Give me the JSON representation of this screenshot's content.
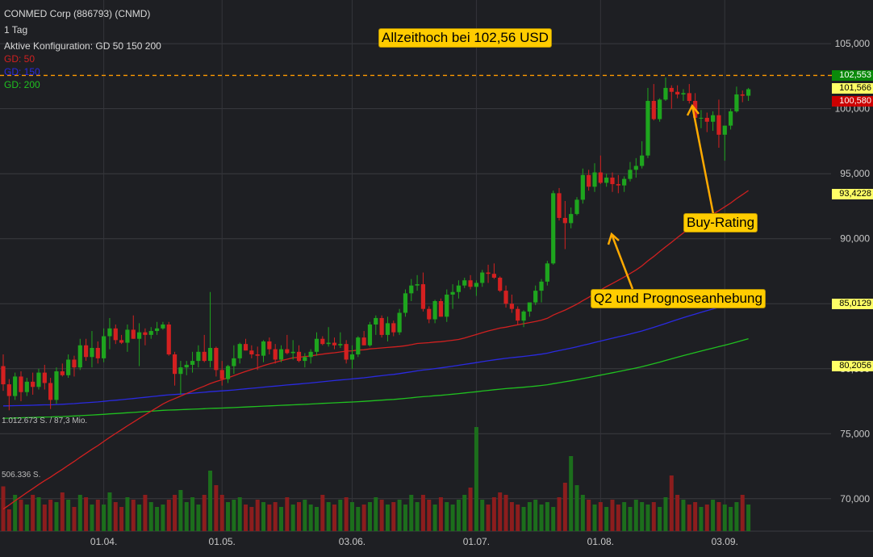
{
  "header": {
    "title": "CONMED Corp (886793) (CNMD)",
    "period": "1 Tag",
    "config": "Aktive Konfiguration: GD 50 150 200",
    "legend": [
      {
        "label": "GD: 50",
        "color": "#d02020"
      },
      {
        "label": "GD: 150",
        "color": "#2a2ae0"
      },
      {
        "label": "GD: 200",
        "color": "#20c020"
      }
    ]
  },
  "annotations": {
    "ath": "Allzeithoch bei 102,56 USD",
    "buy": "Buy-Rating",
    "q2": "Q2 und Prognoseanhebung"
  },
  "price_tags": [
    {
      "label": "102,553",
      "value": 102.553,
      "bg": "#0a8a0a",
      "fg": "#ffffff"
    },
    {
      "label": "101,566",
      "value": 101.566,
      "bg": "#ffff66",
      "fg": "#000000"
    },
    {
      "label": "100,580",
      "value": 100.58,
      "bg": "#cc0000",
      "fg": "#ffffff"
    },
    {
      "label": "93,4228",
      "value": 93.4228,
      "bg": "#ffff66",
      "fg": "#000000"
    },
    {
      "label": "85,0129",
      "value": 85.0129,
      "bg": "#ffff66",
      "fg": "#000000"
    },
    {
      "label": "80,2056",
      "value": 80.2056,
      "bg": "#ffff66",
      "fg": "#000000"
    }
  ],
  "volume_labels": {
    "max": "1.012.673 S. / 87,3 Mio.",
    "mid": "506.336 S."
  },
  "colors": {
    "up": "#1ea51e",
    "down": "#d42020",
    "gd50": "#d02020",
    "gd150": "#2a2ae0",
    "gd200": "#20c020",
    "ath_line": "#ff9900"
  },
  "chart_data": {
    "type": "candlestick",
    "x_ticks": [
      "01.04.",
      "01.05.",
      "03.06.",
      "01.07.",
      "01.08.",
      "03.09."
    ],
    "x_tick_index": [
      17,
      37,
      59,
      80,
      101,
      122
    ],
    "y_ticks": [
      70,
      75,
      80,
      85,
      90,
      95,
      100,
      105
    ],
    "y_tick_labels": [
      "70,000",
      "75,000",
      "80,000",
      "85,000",
      "90,000",
      "95,000",
      "100,000",
      "105,000"
    ],
    "ylim": [
      68,
      106.5
    ],
    "ath": 102.56,
    "candles": [
      [
        80.2,
        81.1,
        78.3,
        78.8
      ],
      [
        78.8,
        79.2,
        76.8,
        77.9
      ],
      [
        77.9,
        79.7,
        77.6,
        79.4
      ],
      [
        79.4,
        79.8,
        77.5,
        78.2
      ],
      [
        78.2,
        79.3,
        77.9,
        79.0
      ],
      [
        79.0,
        79.7,
        78.0,
        78.6
      ],
      [
        78.6,
        80.0,
        78.4,
        79.7
      ],
      [
        79.7,
        80.3,
        78.4,
        78.9
      ],
      [
        78.9,
        79.3,
        76.9,
        77.6
      ],
      [
        77.6,
        80.1,
        77.3,
        79.8
      ],
      [
        79.8,
        80.4,
        79.4,
        79.5
      ],
      [
        79.5,
        81.1,
        79.3,
        80.7
      ],
      [
        80.7,
        81.0,
        79.4,
        80.1
      ],
      [
        80.1,
        82.3,
        79.9,
        81.8
      ],
      [
        81.8,
        82.3,
        80.6,
        80.9
      ],
      [
        80.9,
        82.9,
        80.1,
        81.6
      ],
      [
        81.6,
        82.1,
        80.4,
        80.8
      ],
      [
        80.8,
        83.1,
        80.5,
        82.5
      ],
      [
        82.5,
        83.9,
        81.5,
        83.1
      ],
      [
        83.1,
        83.4,
        81.9,
        82.2
      ],
      [
        82.2,
        82.6,
        81.9,
        82.0
      ],
      [
        82.0,
        83.4,
        81.3,
        83.0
      ],
      [
        83.0,
        84.1,
        82.3,
        82.3
      ],
      [
        82.3,
        83.5,
        80.2,
        82.8
      ],
      [
        82.8,
        83.1,
        81.8,
        82.6
      ],
      [
        82.6,
        83.2,
        82.3,
        82.9
      ],
      [
        82.9,
        83.6,
        82.6,
        83.1
      ],
      [
        83.1,
        83.6,
        83.0,
        83.4
      ],
      [
        83.4,
        83.6,
        81.0,
        81.1
      ],
      [
        81.1,
        81.3,
        78.7,
        79.6
      ],
      [
        79.6,
        80.6,
        78.0,
        80.1
      ],
      [
        80.1,
        80.6,
        79.5,
        80.3
      ],
      [
        80.3,
        81.3,
        79.7,
        80.6
      ],
      [
        80.6,
        81.8,
        80.1,
        81.3
      ],
      [
        81.3,
        82.6,
        80.5,
        80.6
      ],
      [
        80.6,
        85.9,
        80.1,
        81.6
      ],
      [
        81.6,
        81.7,
        79.4,
        79.9
      ],
      [
        79.9,
        80.6,
        78.7,
        79.2
      ],
      [
        79.2,
        80.3,
        78.9,
        80.2
      ],
      [
        80.2,
        81.8,
        79.6,
        80.8
      ],
      [
        80.8,
        82.0,
        80.4,
        81.9
      ],
      [
        81.9,
        82.3,
        81.4,
        81.4
      ],
      [
        81.4,
        81.8,
        80.8,
        81.1
      ],
      [
        81.1,
        81.7,
        79.9,
        81.0
      ],
      [
        81.0,
        82.2,
        80.5,
        82.1
      ],
      [
        82.1,
        82.4,
        81.1,
        81.5
      ],
      [
        81.5,
        81.9,
        80.4,
        80.7
      ],
      [
        80.7,
        81.8,
        80.5,
        81.5
      ],
      [
        81.5,
        82.6,
        81.1,
        81.2
      ],
      [
        81.2,
        82.2,
        80.7,
        81.3
      ],
      [
        81.3,
        81.8,
        80.5,
        80.6
      ],
      [
        80.6,
        81.2,
        80.1,
        80.9
      ],
      [
        80.9,
        81.5,
        80.4,
        81.3
      ],
      [
        81.3,
        82.8,
        81.0,
        82.3
      ],
      [
        82.3,
        82.5,
        81.8,
        81.9
      ],
      [
        81.9,
        83.2,
        81.7,
        82.0
      ],
      [
        82.0,
        82.4,
        81.5,
        81.8
      ],
      [
        81.8,
        82.8,
        81.6,
        81.9
      ],
      [
        81.9,
        82.2,
        80.4,
        80.7
      ],
      [
        80.7,
        81.8,
        80.0,
        81.1
      ],
      [
        81.1,
        82.5,
        80.9,
        82.4
      ],
      [
        82.4,
        82.9,
        81.8,
        81.8
      ],
      [
        81.8,
        83.6,
        81.7,
        83.4
      ],
      [
        83.4,
        84.1,
        82.6,
        83.9
      ],
      [
        83.9,
        84.1,
        82.4,
        82.6
      ],
      [
        82.6,
        84.0,
        82.1,
        83.5
      ],
      [
        83.5,
        83.7,
        82.5,
        82.8
      ],
      [
        82.8,
        84.6,
        82.6,
        84.3
      ],
      [
        84.3,
        86.1,
        84.0,
        85.8
      ],
      [
        85.8,
        86.9,
        85.2,
        86.4
      ],
      [
        86.4,
        87.2,
        86.0,
        86.5
      ],
      [
        86.5,
        87.4,
        84.4,
        84.6
      ],
      [
        84.6,
        84.8,
        83.5,
        83.8
      ],
      [
        83.8,
        85.3,
        83.5,
        85.2
      ],
      [
        85.2,
        85.4,
        84.0,
        84.0
      ],
      [
        84.0,
        86.1,
        83.6,
        85.7
      ],
      [
        85.7,
        86.5,
        84.6,
        85.9
      ],
      [
        85.9,
        86.8,
        85.4,
        86.4
      ],
      [
        86.4,
        87.0,
        86.2,
        86.8
      ],
      [
        86.8,
        87.2,
        86.1,
        86.3
      ],
      [
        86.3,
        86.8,
        85.6,
        86.6
      ],
      [
        86.6,
        87.6,
        86.3,
        87.4
      ],
      [
        87.4,
        88.0,
        86.6,
        87.3
      ],
      [
        87.3,
        88.1,
        86.9,
        87.0
      ],
      [
        87.0,
        87.1,
        85.9,
        86.0
      ],
      [
        86.0,
        86.4,
        84.7,
        85.0
      ],
      [
        85.0,
        85.7,
        84.3,
        84.6
      ],
      [
        84.6,
        84.8,
        83.4,
        83.7
      ],
      [
        83.7,
        84.5,
        83.2,
        84.4
      ],
      [
        84.4,
        85.0,
        84.0,
        85.1
      ],
      [
        85.1,
        86.4,
        84.9,
        86.0
      ],
      [
        86.0,
        86.9,
        85.1,
        86.7
      ],
      [
        86.7,
        88.3,
        86.4,
        88.1
      ],
      [
        88.1,
        93.7,
        88.0,
        93.5
      ],
      [
        93.5,
        93.9,
        91.4,
        91.6
      ],
      [
        91.6,
        92.9,
        89.2,
        91.2
      ],
      [
        91.2,
        92.4,
        90.8,
        91.9
      ],
      [
        91.9,
        93.2,
        91.8,
        93.0
      ],
      [
        93.0,
        95.4,
        92.7,
        94.9
      ],
      [
        94.9,
        95.3,
        93.7,
        94.0
      ],
      [
        94.0,
        95.8,
        93.6,
        95.1
      ],
      [
        95.1,
        96.4,
        94.2,
        94.3
      ],
      [
        94.3,
        95.0,
        94.0,
        94.7
      ],
      [
        94.7,
        95.1,
        93.6,
        94.2
      ],
      [
        94.2,
        94.9,
        93.5,
        94.1
      ],
      [
        94.1,
        94.8,
        93.6,
        94.6
      ],
      [
        94.6,
        95.9,
        94.4,
        95.3
      ],
      [
        95.3,
        96.2,
        94.7,
        95.6
      ],
      [
        95.6,
        97.5,
        95.4,
        96.4
      ],
      [
        96.4,
        101.6,
        96.2,
        100.6
      ],
      [
        100.6,
        101.9,
        99.1,
        99.2
      ],
      [
        99.2,
        100.8,
        99.0,
        100.7
      ],
      [
        100.7,
        102.4,
        100.6,
        101.6
      ],
      [
        101.6,
        101.8,
        100.0,
        101.3
      ],
      [
        101.3,
        101.8,
        100.8,
        101.1
      ],
      [
        101.1,
        101.5,
        100.6,
        101.2
      ],
      [
        101.2,
        101.9,
        100.4,
        100.6
      ],
      [
        100.6,
        101.2,
        98.9,
        99.3
      ],
      [
        99.3,
        99.9,
        98.5,
        99.3
      ],
      [
        99.3,
        99.7,
        98.2,
        99.0
      ],
      [
        99.0,
        99.8,
        98.3,
        99.5
      ],
      [
        99.5,
        100.7,
        97.0,
        98.0
      ],
      [
        98.0,
        98.4,
        96.0,
        98.7
      ],
      [
        98.7,
        100.0,
        98.4,
        99.8
      ],
      [
        99.8,
        101.7,
        99.7,
        101.1
      ],
      [
        101.1,
        101.4,
        100.5,
        101.0
      ],
      [
        101.0,
        101.6,
        100.6,
        101.5
      ]
    ],
    "volumes": [
      0.37,
      0.18,
      0.3,
      0.26,
      0.22,
      0.3,
      0.28,
      0.22,
      0.26,
      0.24,
      0.32,
      0.26,
      0.2,
      0.3,
      0.28,
      0.22,
      0.26,
      0.22,
      0.32,
      0.24,
      0.2,
      0.28,
      0.26,
      0.22,
      0.3,
      0.24,
      0.2,
      0.22,
      0.26,
      0.3,
      0.34,
      0.24,
      0.28,
      0.22,
      0.3,
      0.5,
      0.38,
      0.3,
      0.24,
      0.26,
      0.28,
      0.22,
      0.2,
      0.26,
      0.24,
      0.22,
      0.24,
      0.2,
      0.28,
      0.22,
      0.24,
      0.26,
      0.22,
      0.2,
      0.3,
      0.24,
      0.22,
      0.26,
      0.28,
      0.24,
      0.2,
      0.22,
      0.24,
      0.28,
      0.26,
      0.22,
      0.24,
      0.26,
      0.22,
      0.3,
      0.24,
      0.3,
      0.26,
      0.22,
      0.28,
      0.24,
      0.22,
      0.26,
      0.3,
      0.36,
      0.86,
      0.26,
      0.22,
      0.28,
      0.32,
      0.3,
      0.24,
      0.22,
      0.2,
      0.24,
      0.26,
      0.22,
      0.24,
      0.2,
      0.28,
      0.4,
      0.62,
      0.38,
      0.3,
      0.26,
      0.22,
      0.24,
      0.2,
      0.26,
      0.22,
      0.24,
      0.2,
      0.26,
      0.24,
      0.22,
      0.24,
      0.2,
      0.28,
      0.46,
      0.3,
      0.26,
      0.22,
      0.24,
      0.2,
      0.22,
      0.26,
      0.24,
      0.22,
      0.2,
      0.24,
      0.3,
      0.22,
      0.24,
      0.2,
      0.22,
      0.24
    ]
  }
}
